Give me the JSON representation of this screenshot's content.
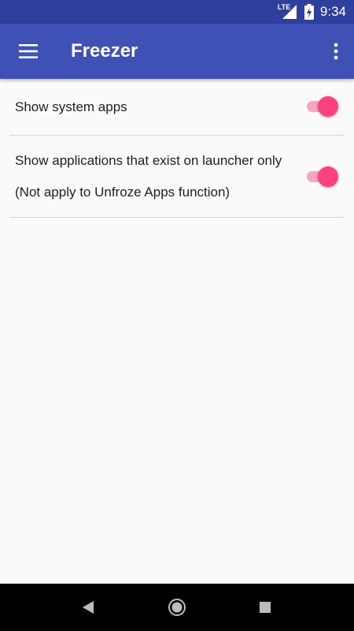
{
  "status_bar": {
    "network": "LTE",
    "time": "9:34"
  },
  "app_bar": {
    "title": "Freezer",
    "menu_icon": "hamburger-menu-icon",
    "overflow_icon": "more-vert-icon"
  },
  "settings": [
    {
      "label": "Show system apps",
      "enabled": true
    },
    {
      "label": "Show applications that exist on launcher only",
      "sublabel": "(Not apply to Unfroze Apps function)",
      "enabled": true
    }
  ],
  "colors": {
    "status_bar": "#2f3f9e",
    "app_bar": "#3f51b5",
    "accent": "#ff4081",
    "divider": "#f6c5d1",
    "background": "#fafafa"
  },
  "nav_bar": {
    "icons": [
      "back-icon",
      "home-icon",
      "recents-icon"
    ]
  }
}
